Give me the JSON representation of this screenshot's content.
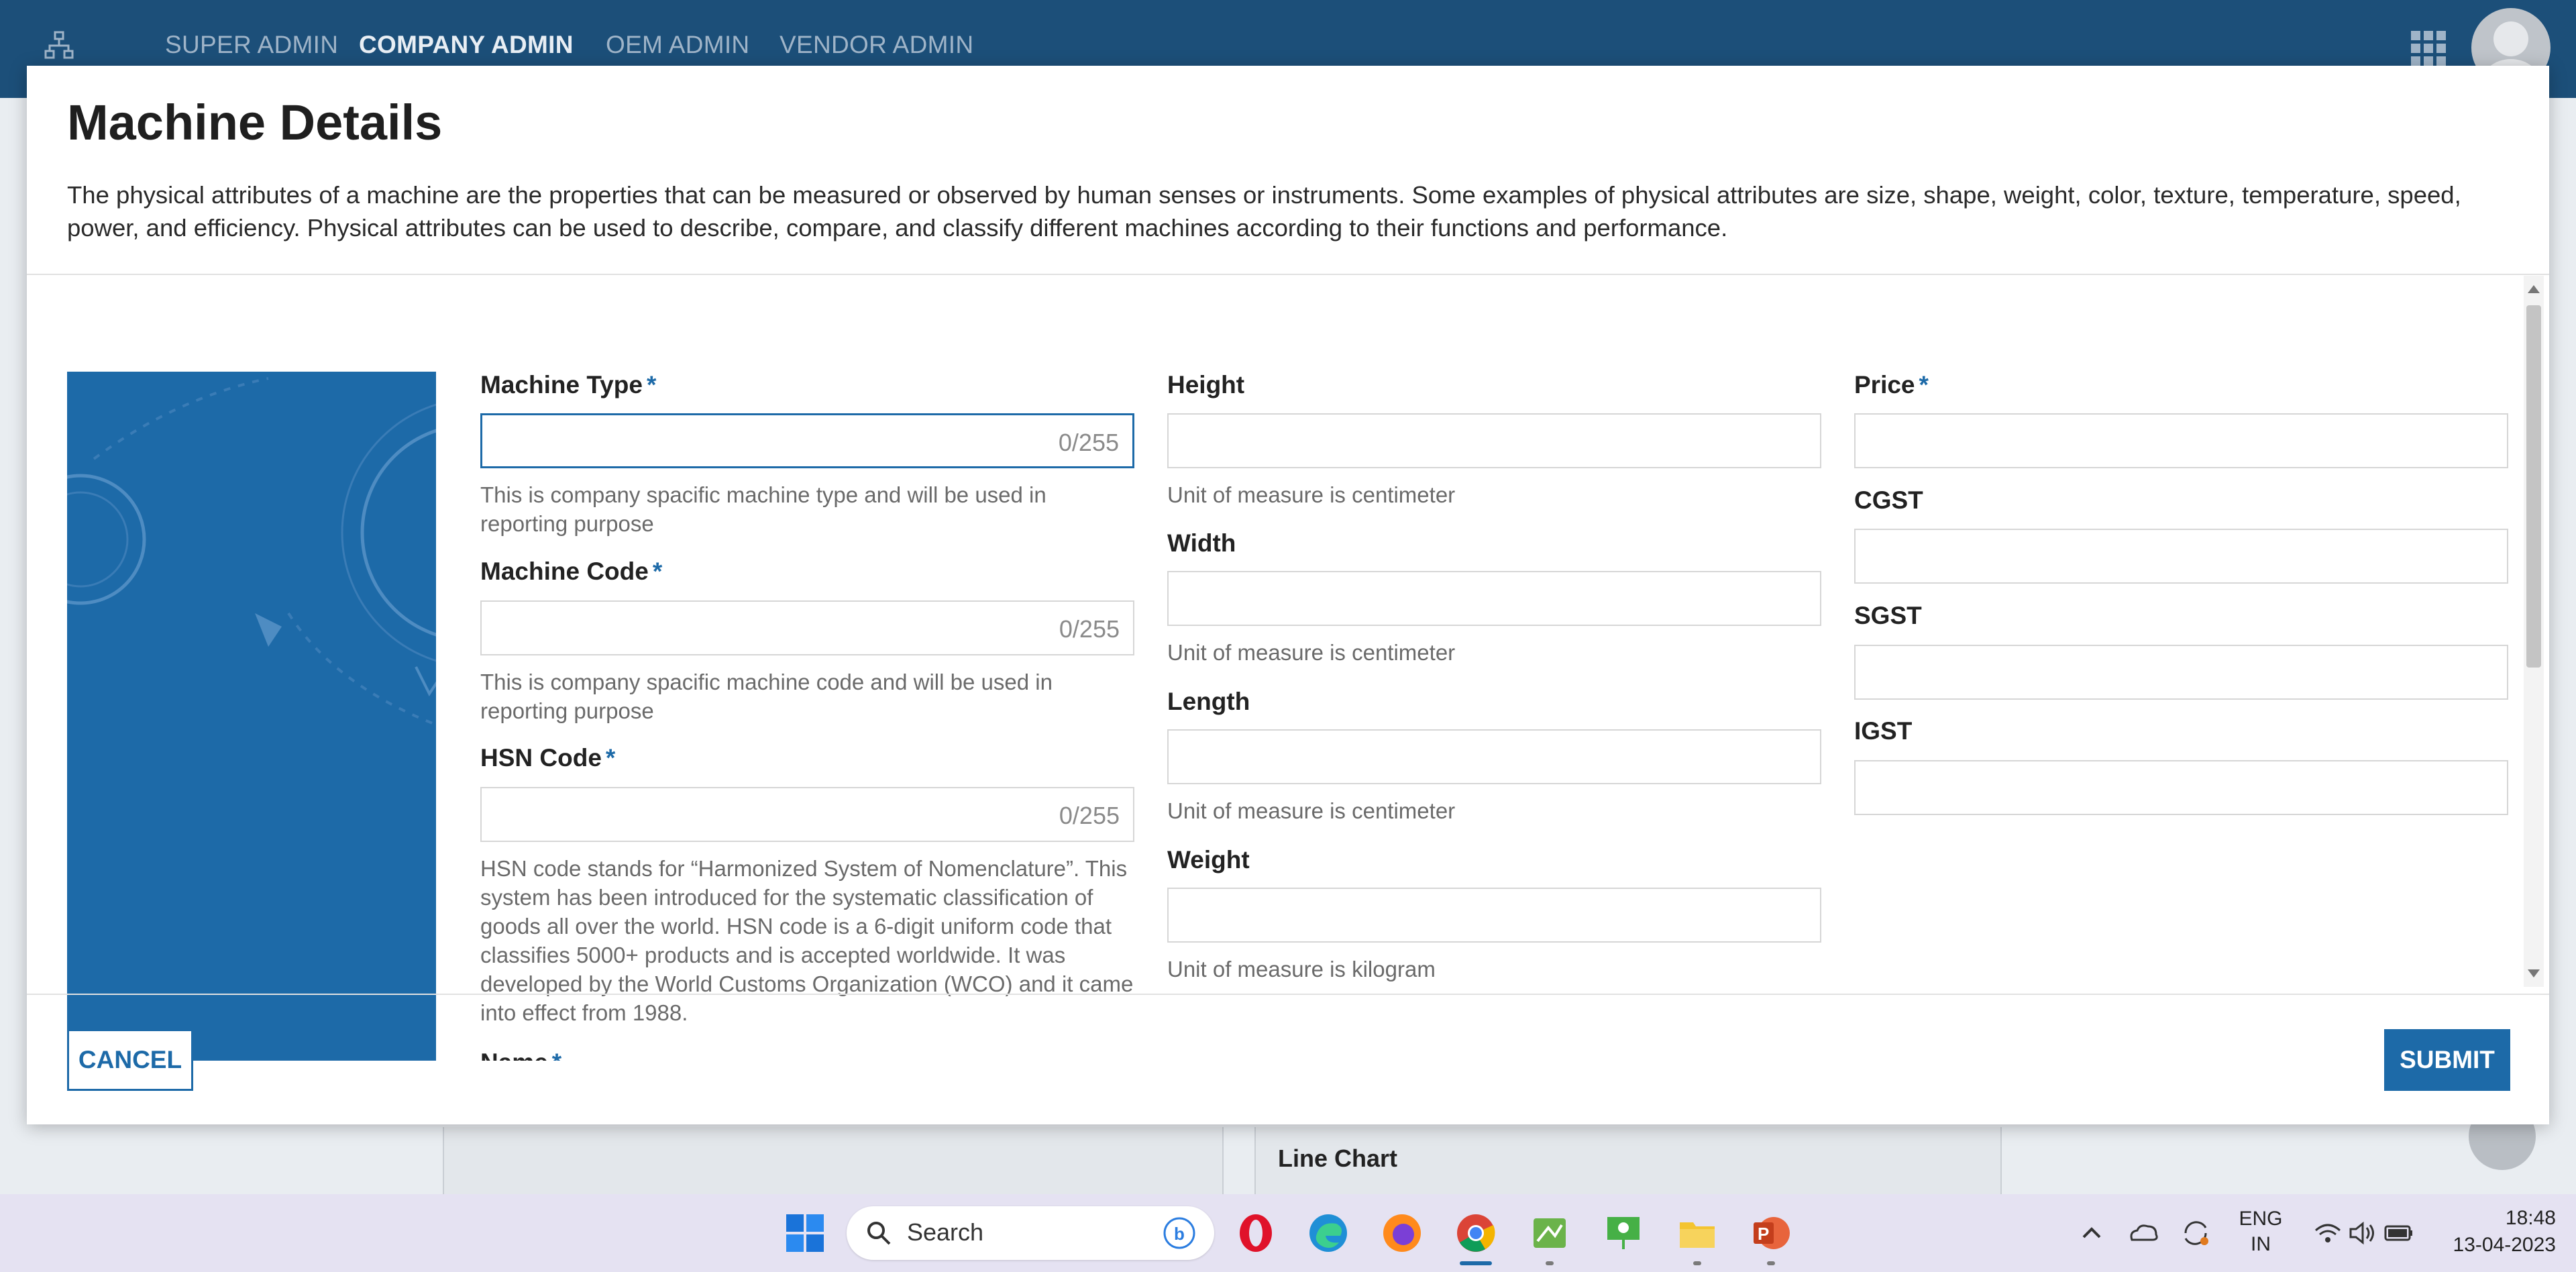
{
  "nav": {
    "items": [
      "SUPER ADMIN",
      "COMPANY ADMIN",
      "OEM ADMIN",
      "VENDOR ADMIN"
    ],
    "active": "COMPANY ADMIN"
  },
  "background": {
    "panel_label": "Line Chart"
  },
  "dialog": {
    "title": "Machine Details",
    "description": "The physical attributes of a machine are the properties that can be measured or observed by human senses or instruments. Some examples of physical attributes are size, shape, weight, color, texture, temperature, speed, power, and efficiency. Physical attributes can be used to describe, compare, and classify different machines according to their functions and performance.",
    "required_mark": "*",
    "col1": {
      "machine_type": {
        "label": "Machine Type",
        "value": "",
        "counter": "0/255",
        "help": "This is company spacific machine type and will be used in reporting purpose"
      },
      "machine_code": {
        "label": "Machine Code",
        "value": "",
        "counter": "0/255",
        "help": "This is company spacific machine code and will be used in reporting purpose"
      },
      "hsn_code": {
        "label": "HSN Code",
        "value": "",
        "counter": "0/255",
        "help": "HSN code stands for “Harmonized System of Nomenclature”. This system has been introduced for the systematic classification of goods all over the world. HSN code is a 6-digit uniform code that classifies 5000+ products and is accepted worldwide. It was developed by the World Customs Organization (WCO) and it came into effect from 1988."
      },
      "name": {
        "label": "Name"
      }
    },
    "col2": {
      "height": {
        "label": "Height",
        "value": "",
        "help": "Unit of measure is centimeter"
      },
      "width": {
        "label": "Width",
        "value": "",
        "help": "Unit of measure is centimeter"
      },
      "length": {
        "label": "Length",
        "value": "",
        "help": "Unit of measure is centimeter"
      },
      "weight": {
        "label": "Weight",
        "value": "",
        "help": "Unit of measure is kilogram"
      }
    },
    "col3": {
      "price": {
        "label": "Price",
        "value": ""
      },
      "cgst": {
        "label": "CGST",
        "value": ""
      },
      "sgst": {
        "label": "SGST",
        "value": ""
      },
      "igst": {
        "label": "IGST",
        "value": ""
      }
    },
    "cancel_label": "CANCEL",
    "submit_label": "SUBMIT"
  },
  "taskbar": {
    "search_placeholder": "Search",
    "language_line1": "ENG",
    "language_line2": "IN",
    "time": "18:48",
    "date": "13-04-2023",
    "apps": [
      "start-icon",
      "opera-icon",
      "edge-icon",
      "firefox-icon",
      "chrome-icon",
      "paint-icon",
      "presentation-icon",
      "file-explorer-icon",
      "powerpoint-icon"
    ]
  },
  "colors": {
    "nav_bg": "#1c4f79",
    "accent": "#1d6aa8",
    "taskbar_bg": "#e5e2f2"
  }
}
